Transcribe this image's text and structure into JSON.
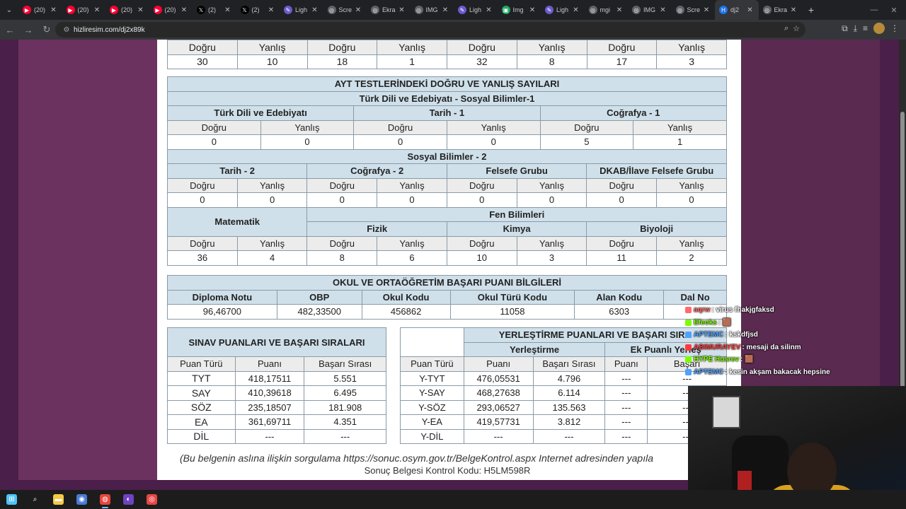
{
  "browser": {
    "tabs": [
      {
        "title": "(20)",
        "icon": "youtube-icon",
        "color": "#ff0033"
      },
      {
        "title": "(20)",
        "icon": "youtube-icon",
        "color": "#ff0033"
      },
      {
        "title": "(20)",
        "icon": "youtube-icon",
        "color": "#ff0033"
      },
      {
        "title": "(20)",
        "icon": "youtube-icon",
        "color": "#ff0033"
      },
      {
        "title": "(2)",
        "icon": "x-icon",
        "color": "#000000"
      },
      {
        "title": "(2)",
        "icon": "x-icon",
        "color": "#000000"
      },
      {
        "title": "Ligh",
        "icon": "pen-icon",
        "color": "#6a5acd"
      },
      {
        "title": "Scre",
        "icon": "globe-icon",
        "color": "#5f6368"
      },
      {
        "title": "Ekra",
        "icon": "globe-icon",
        "color": "#5f6368"
      },
      {
        "title": "IMG",
        "icon": "globe-icon",
        "color": "#5f6368"
      },
      {
        "title": "Ligh",
        "icon": "pen-icon",
        "color": "#6a5acd"
      },
      {
        "title": "Img",
        "icon": "image-icon",
        "color": "#1fa463"
      },
      {
        "title": "Ligh",
        "icon": "pen-icon",
        "color": "#6a5acd"
      },
      {
        "title": "mgi",
        "icon": "globe-icon",
        "color": "#5f6368"
      },
      {
        "title": "IMG",
        "icon": "globe-icon",
        "color": "#5f6368"
      },
      {
        "title": "Scre",
        "icon": "globe-icon",
        "color": "#5f6368"
      },
      {
        "title": "dj2",
        "icon": "h-icon",
        "color": "#1a73e8",
        "active": true
      },
      {
        "title": "Ekra",
        "icon": "globe-icon",
        "color": "#5f6368"
      }
    ],
    "url": "hizliresim.com/dj2x89k"
  },
  "document": {
    "tyt_top": {
      "headers": [
        "Doğru",
        "Yanlış",
        "Doğru",
        "Yanlış",
        "Doğru",
        "Yanlış",
        "Doğru",
        "Yanlış"
      ],
      "values": [
        "30",
        "10",
        "18",
        "1",
        "32",
        "8",
        "17",
        "3"
      ]
    },
    "ayt": {
      "title": "AYT TESTLERİNDEKİ DOĞRU VE YANLIŞ SAYILARI",
      "section1_title": "Türk Dili ve Edebiyatı - Sosyal Bilimler-1",
      "section1_subjects": [
        "Türk Dili ve Edebiyatı",
        "Tarih - 1",
        "Coğrafya - 1"
      ],
      "section1_headers": [
        "Doğru",
        "Yanlış",
        "Doğru",
        "Yanlış",
        "Doğru",
        "Yanlış"
      ],
      "section1_values": [
        "0",
        "0",
        "0",
        "0",
        "5",
        "1"
      ],
      "section2_title": "Sosyal Bilimler - 2",
      "section2_subjects": [
        "Tarih - 2",
        "Coğrafya - 2",
        "Felsefe Grubu",
        "DKAB/İlave Felsefe Grubu"
      ],
      "section2_headers": [
        "Doğru",
        "Yanlış",
        "Doğru",
        "Yanlış",
        "Doğru",
        "Yanlış",
        "Doğru",
        "Yanlış"
      ],
      "section2_values": [
        "0",
        "0",
        "0",
        "0",
        "0",
        "0",
        "0",
        "0"
      ],
      "section3_math": "Matematik",
      "section3_science": "Fen Bilimleri",
      "section3_subjects": [
        "Fizik",
        "Kimya",
        "Biyoloji"
      ],
      "section3_headers": [
        "Doğru",
        "Yanlış",
        "Doğru",
        "Yanlış",
        "Doğru",
        "Yanlış",
        "Doğru",
        "Yanlış"
      ],
      "section3_values": [
        "36",
        "4",
        "8",
        "6",
        "10",
        "3",
        "11",
        "2"
      ]
    },
    "school": {
      "title": "OKUL VE ORTAÖĞRETİM BAŞARI PUANI BİLGİLERİ",
      "headers": [
        "Diploma Notu",
        "OBP",
        "Okul Kodu",
        "Okul Türü Kodu",
        "Alan Kodu",
        "Dal No"
      ],
      "values": [
        "96,46700",
        "482,33500",
        "456862",
        "11058",
        "6303",
        ""
      ]
    },
    "exam_scores": {
      "title": "SINAV PUANLARI VE BAŞARI SIRALARI",
      "headers": [
        "Puan Türü",
        "Puanı",
        "Başarı Sırası"
      ],
      "rows": [
        [
          "TYT",
          "418,17511",
          "5.551"
        ],
        [
          "SAY",
          "410,39618",
          "6.495"
        ],
        [
          "SÖZ",
          "235,18507",
          "181.908"
        ],
        [
          "EA",
          "361,69711",
          "4.351"
        ],
        [
          "DİL",
          "---",
          "---"
        ]
      ]
    },
    "placement": {
      "title": "YERLEŞTİRME PUANLARI VE BAŞARI SIRA",
      "group1": "Yerleştirme",
      "group2": "Ek Puanlı Yerleş",
      "headers": [
        "Puan Türü",
        "Puanı",
        "Başarı Sırası",
        "Puanı",
        "Başarı"
      ],
      "rows": [
        [
          "Y-TYT",
          "476,05531",
          "4.796",
          "---",
          "---"
        ],
        [
          "Y-SAY",
          "468,27638",
          "6.114",
          "---",
          "---"
        ],
        [
          "Y-SÖZ",
          "293,06527",
          "135.563",
          "---",
          "---"
        ],
        [
          "Y-EA",
          "419,57731",
          "3.812",
          "---",
          "---"
        ],
        [
          "Y-DİL",
          "---",
          "---",
          "---",
          "---"
        ]
      ]
    },
    "footnote": "(Bu belgenin aslına ilişkin sorgulama https://sonuc.osym.gov.tr/BelgeKontrol.aspx Internet adresinden yapıla",
    "control_code": "Sonuç Belgesi Kontrol Kodu: H5LM598R"
  },
  "chat": [
    {
      "user": "aqrw",
      "message": ": virus fhakjgfaksd",
      "color": "#ff6b6b"
    },
    {
      "user": "Efeoks",
      "message": ": 🟫",
      "color": "#7cfc00"
    },
    {
      "user": "APTEMC",
      "message": ": kskdfjsd",
      "color": "#4ea1ff"
    },
    {
      "user": "ABIMURAYEV",
      "message": ": mesaji da silinm",
      "color": "#ff3b3b"
    },
    {
      "user": "HYPE Husrev",
      "message": ": 🟫",
      "color": "#7cfc00"
    },
    {
      "user": "APTEMC",
      "message": ": kesin akşam bakacak hepsine",
      "color": "#4ea1ff"
    }
  ],
  "taskbar": [
    {
      "icon": "windows-start-icon",
      "color": "#4fc3f7"
    },
    {
      "icon": "search-icon",
      "color": "#dddddd"
    },
    {
      "icon": "file-explorer-icon",
      "color": "#f6c945"
    },
    {
      "icon": "app-icon",
      "color": "#4a7bd6"
    },
    {
      "icon": "chrome-icon",
      "color": "#e8453c",
      "active": true
    },
    {
      "icon": "obs-icon",
      "color": "#6f42c1"
    },
    {
      "icon": "recorder-icon",
      "color": "#e84646"
    }
  ]
}
